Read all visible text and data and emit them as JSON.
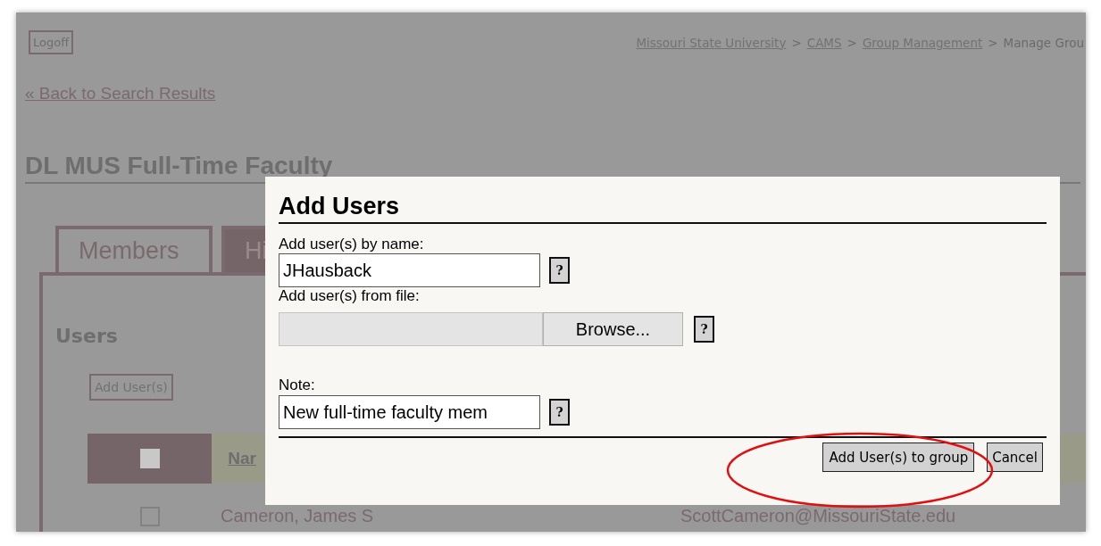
{
  "header": {
    "logoff_button": "Logoff",
    "breadcrumb": [
      {
        "label": "Missouri State University",
        "kind": "link"
      },
      {
        "label": ">",
        "kind": "separator"
      },
      {
        "label": "CAMS",
        "kind": "link"
      },
      {
        "label": ">",
        "kind": "separator"
      },
      {
        "label": "Group Management",
        "kind": "link"
      },
      {
        "label": ">",
        "kind": "separator"
      },
      {
        "label": "Manage Grou",
        "kind": "current"
      }
    ]
  },
  "back_link": "« Back to Search Results",
  "group_title": "DL MUS Full-Time Faculty",
  "tabs": [
    {
      "label": "Members",
      "selected": true
    },
    {
      "label": "Hi",
      "selected": false
    }
  ],
  "users_section": {
    "heading": "Users",
    "add_button": "Add User(s)",
    "table": {
      "header_checkbox": {
        "checked": false
      },
      "columns": [
        "Nar"
      ],
      "rows": [
        {
          "checked": false,
          "name": "Cameron, James S",
          "email": "ScottCameron@MissouriState.edu"
        }
      ]
    }
  },
  "dialog": {
    "title": "Add Users",
    "name_label": "Add user(s) by name:",
    "name_value": "JHausback",
    "name_help": "?",
    "file_label": "Add user(s) from file:",
    "browse_button": "Browse...",
    "file_help": "?",
    "note_label": "Note:",
    "note_value": "New full-time faculty mem",
    "note_help": "?",
    "buttons": [
      {
        "label": "Add User(s) to group",
        "kind": "primary"
      },
      {
        "label": "Cancel",
        "kind": "secondary"
      }
    ]
  }
}
